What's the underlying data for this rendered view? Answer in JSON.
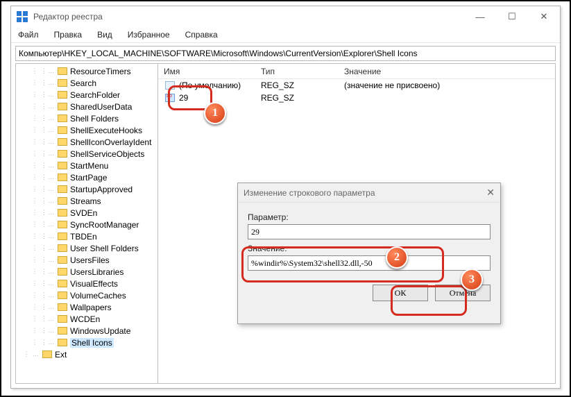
{
  "window": {
    "title": "Редактор реестра",
    "controls": {
      "min": "—",
      "max": "☐",
      "close": "✕"
    }
  },
  "menu": {
    "file": "Файл",
    "edit": "Правка",
    "view": "Вид",
    "fav": "Избранное",
    "help": "Справка"
  },
  "address": "Компьютер\\HKEY_LOCAL_MACHINE\\SOFTWARE\\Microsoft\\Windows\\CurrentVersion\\Explorer\\Shell Icons",
  "tree": {
    "items": [
      "ResourceTimers",
      "Search",
      "SearchFolder",
      "SharedUserData",
      "Shell Folders",
      "ShellExecuteHooks",
      "ShellIconOverlayIdent",
      "ShellServiceObjects",
      "StartMenu",
      "StartPage",
      "StartupApproved",
      "Streams",
      "SVDEn",
      "SyncRootManager",
      "TBDEn",
      "User Shell Folders",
      "UsersFiles",
      "UsersLibraries",
      "VisualEffects",
      "VolumeCaches",
      "Wallpapers",
      "WCDEn",
      "WindowsUpdate",
      "Shell Icons",
      "Ext"
    ],
    "selectedIndex": 23
  },
  "list": {
    "headers": {
      "name": "Имя",
      "type": "Тип",
      "value": "Значение"
    },
    "rows": [
      {
        "name": "(По умолчанию)",
        "type": "REG_SZ",
        "value": "(значение не присвоено)"
      },
      {
        "name": "29",
        "type": "REG_SZ",
        "value": ""
      }
    ]
  },
  "dialog": {
    "title": "Изменение строкового параметра",
    "paramLabel": "Параметр:",
    "paramValue": "29",
    "valueLabel": "Значение:",
    "valueValue": "%windir%\\System32\\shell32.dll,-50",
    "ok": "ОК",
    "cancel": "Отмена"
  },
  "badges": {
    "b1": "1",
    "b2": "2",
    "b3": "3"
  }
}
